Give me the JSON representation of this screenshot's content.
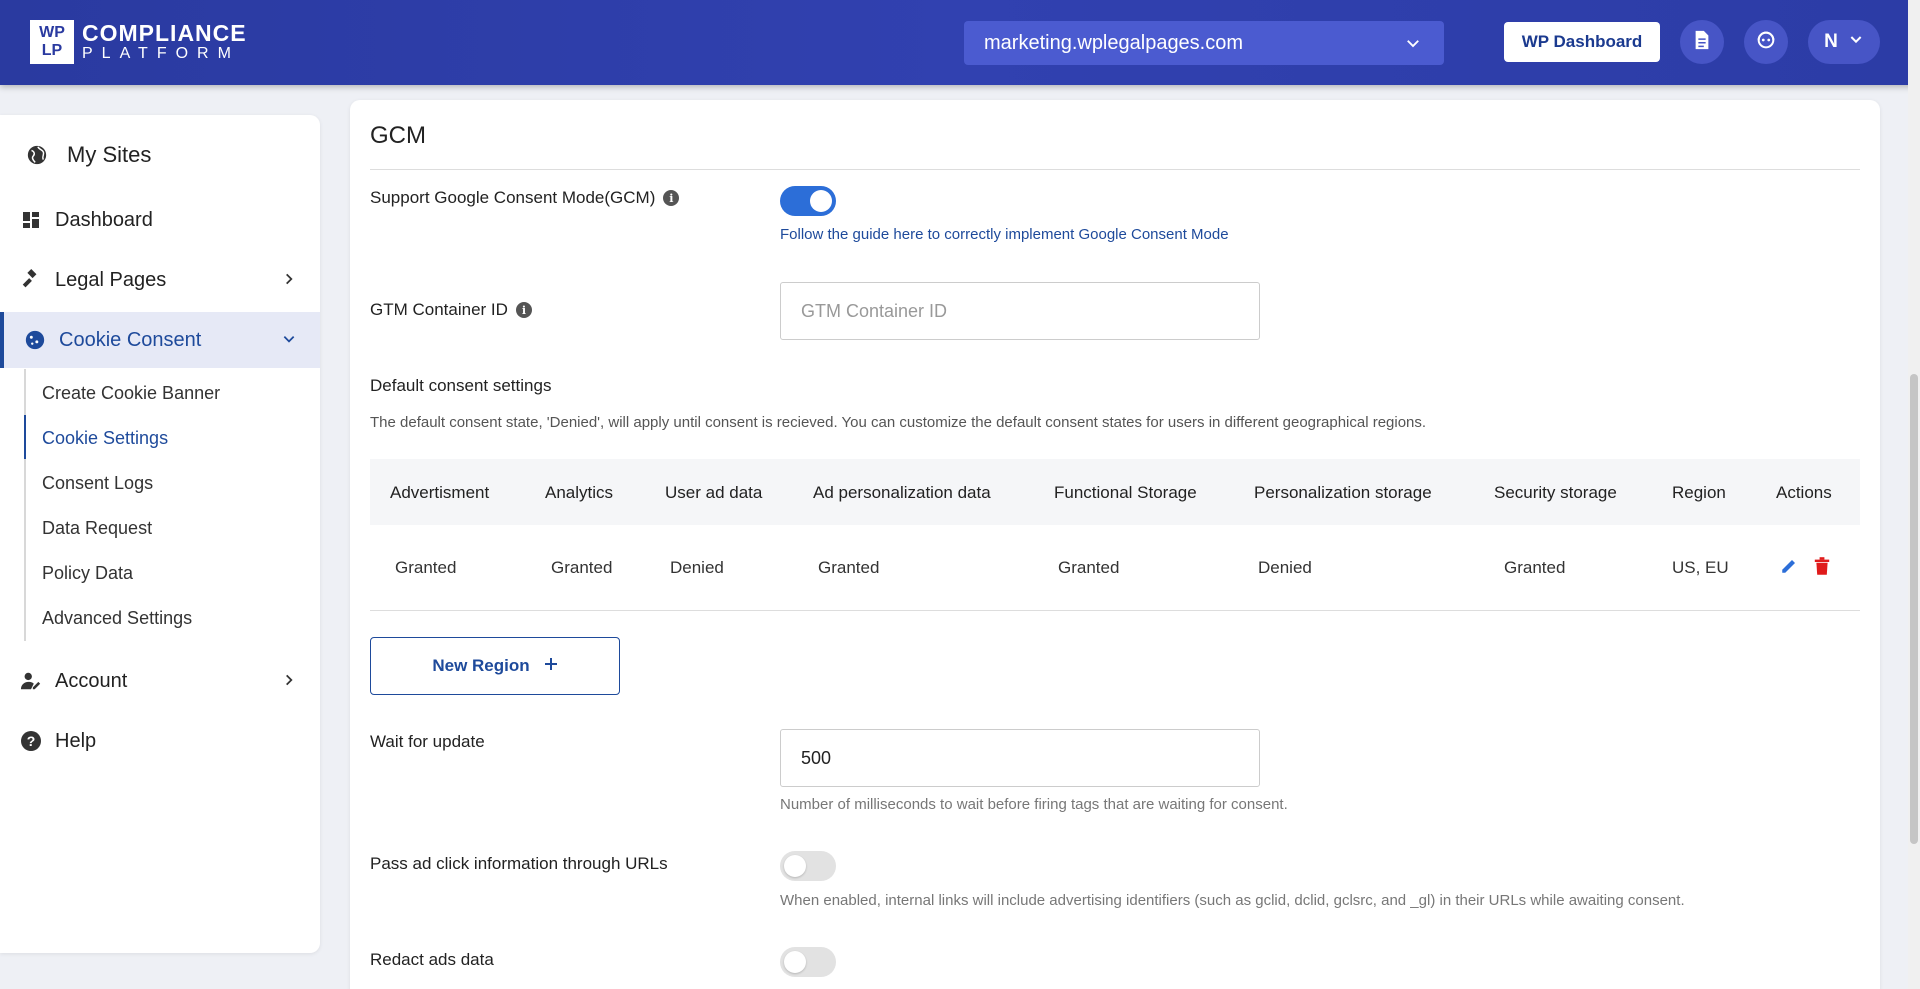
{
  "header": {
    "logo_top": "WP",
    "logo_bottom": "LP",
    "logo_title": "COMPLIANCE",
    "logo_subtitle": "PLATFORM",
    "site": "marketing.wplegalpages.com",
    "wp_dashboard_label": "WP Dashboard",
    "user_initial": "N"
  },
  "sidebar": {
    "items": [
      {
        "label": "My Sites",
        "icon": "globe-icon"
      },
      {
        "label": "Dashboard",
        "icon": "dashboard-icon"
      },
      {
        "label": "Legal Pages",
        "icon": "gavel-icon"
      },
      {
        "label": "Cookie Consent",
        "icon": "cookie-icon"
      },
      {
        "label": "Account",
        "icon": "account-icon"
      },
      {
        "label": "Help",
        "icon": "help-icon"
      }
    ],
    "sub_items": [
      "Create Cookie Banner",
      "Cookie Settings",
      "Consent Logs",
      "Data Request",
      "Policy Data",
      "Advanced Settings"
    ],
    "active_sub": "Cookie Settings"
  },
  "main": {
    "title": "GCM",
    "gcm_label": "Support Google Consent Mode(GCM)",
    "gcm_enabled": true,
    "guide_link": "Follow the guide here to correctly implement Google Consent Mode",
    "gtm_label": "GTM Container ID",
    "gtm_placeholder": "GTM Container ID",
    "gtm_value": "",
    "default_heading": "Default consent settings",
    "default_desc": "The default consent state, 'Denied', will apply until consent is recieved. You can customize the default consent states for users in different geographical regions.",
    "table": {
      "headers": [
        "Advertisment",
        "Analytics",
        "User ad data",
        "Ad personalization data",
        "Functional Storage",
        "Personalization storage",
        "Security storage",
        "Region",
        "Actions"
      ],
      "rows": [
        [
          "Granted",
          "Granted",
          "Denied",
          "Granted",
          "Granted",
          "Denied",
          "Granted",
          "US, EU"
        ]
      ]
    },
    "new_region_label": "New Region",
    "wait_label": "Wait for update",
    "wait_value": "500",
    "wait_help": "Number of milliseconds to wait before firing tags that are waiting for consent.",
    "pass_ad_label": "Pass ad click information through URLs",
    "pass_ad_enabled": false,
    "pass_ad_help": "When enabled, internal links will include advertising identifiers (such as gclid, dclid, gclsrc, and _gl) in their URLs while awaiting consent.",
    "redact_label": "Redact ads data",
    "redact_enabled": false
  },
  "colors": {
    "header": "#2a3aa0",
    "accent": "#1e4a9b",
    "toggle_on": "#2c6ed8",
    "delete": "#e01b1b"
  }
}
